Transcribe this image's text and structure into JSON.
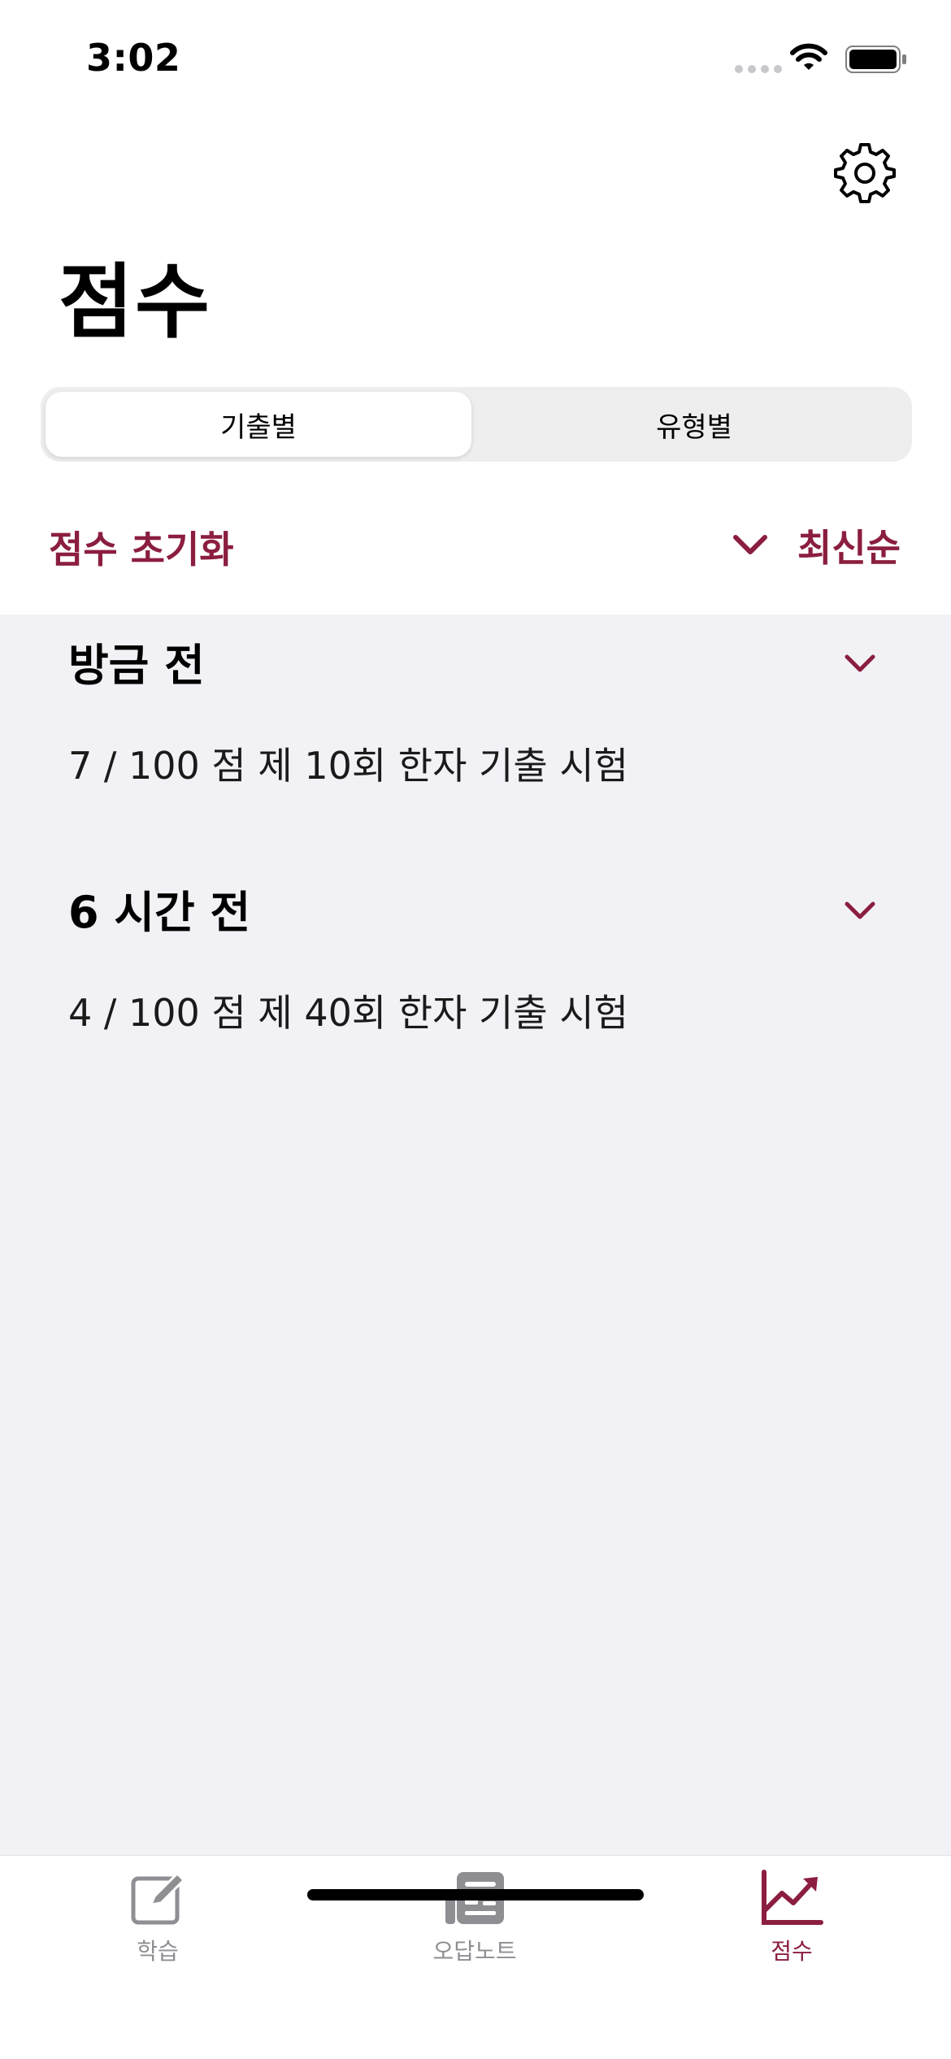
{
  "status_bar": {
    "time": "3:02"
  },
  "header": {
    "title": "점수"
  },
  "segmented_control": {
    "options": [
      {
        "label": "기출별",
        "selected": true
      },
      {
        "label": "유형별",
        "selected": false
      }
    ]
  },
  "actions": {
    "reset_label": "점수 초기화",
    "sort_label": "최신순"
  },
  "groups": [
    {
      "title": "방금 전",
      "items": [
        {
          "text": "7 / 100 점  제 10회 한자 기출 시험"
        }
      ]
    },
    {
      "title": "6 시간 전",
      "items": [
        {
          "text": "4 / 100 점  제 40회 한자 기출 시험"
        }
      ]
    }
  ],
  "tab_bar": {
    "tabs": [
      {
        "label": "학습",
        "icon": "edit-icon",
        "active": false
      },
      {
        "label": "오답노트",
        "icon": "newspaper-icon",
        "active": false
      },
      {
        "label": "점수",
        "icon": "chart-up-icon",
        "active": true
      }
    ]
  },
  "colors": {
    "accent": "#8b1e3f",
    "background_list": "#f1f1f6",
    "inactive_tab": "#8e8e93"
  }
}
